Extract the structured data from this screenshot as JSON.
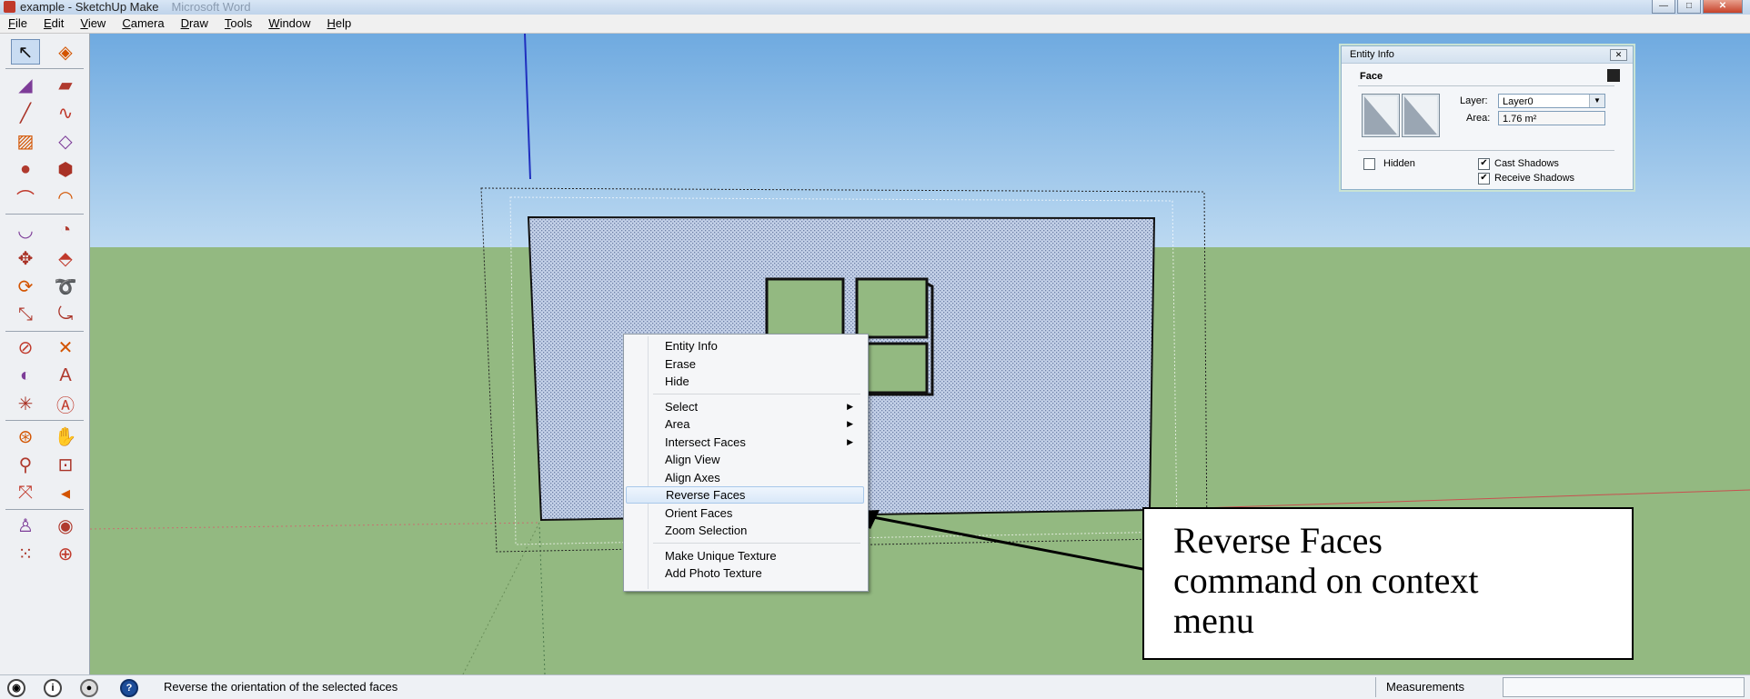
{
  "window": {
    "title": "example - SketchUp Make",
    "title_extra": "Microsoft Word",
    "controls": {
      "minimize": "—",
      "maximize": "□",
      "close": "✕"
    }
  },
  "menubar": {
    "items": [
      {
        "key": "F",
        "rest": "ile"
      },
      {
        "key": "E",
        "rest": "dit"
      },
      {
        "key": "V",
        "rest": "iew"
      },
      {
        "key": "C",
        "rest": "amera"
      },
      {
        "key": "D",
        "rest": "raw"
      },
      {
        "key": "T",
        "rest": "ools"
      },
      {
        "key": "W",
        "rest": "indow"
      },
      {
        "key": "H",
        "rest": "elp"
      }
    ]
  },
  "toolbar": {
    "tools": [
      "select-icon",
      "make-component-icon",
      "paint-bucket-icon",
      "eraser-icon",
      "line-icon",
      "freehand-icon",
      "rectangle-icon",
      "rotated-rectangle-icon",
      "circle-icon",
      "polygon-icon",
      "arc-icon",
      "two-point-arc-icon",
      "three-point-arc-icon",
      "pie-icon",
      "move-icon",
      "push-pull-icon",
      "rotate-icon",
      "follow-me-icon",
      "scale-icon",
      "offset-icon",
      "tape-measure-icon",
      "dimension-icon",
      "protractor-icon",
      "text-icon",
      "axes-icon",
      "3d-text-icon",
      "orbit-icon",
      "pan-icon",
      "zoom-icon",
      "zoom-window-icon",
      "zoom-extents-icon",
      "previous-view-icon",
      "position-camera-icon",
      "look-around-icon",
      "walk-icon",
      "section-plane-icon"
    ]
  },
  "entity_info": {
    "title": "Entity Info",
    "close": "✕",
    "type": "Face",
    "layer_label": "Layer:",
    "layer_value": "Layer0",
    "area_label": "Area:",
    "area_value": "1.76 m²",
    "hidden_label": "Hidden",
    "hidden_checked": false,
    "cast_shadows_label": "Cast Shadows",
    "cast_shadows_checked": true,
    "receive_shadows_label": "Receive Shadows",
    "receive_shadows_checked": true,
    "check_mark": "✔"
  },
  "context_menu": {
    "items": [
      {
        "label": "Entity Info",
        "submenu": false
      },
      {
        "label": "Erase",
        "submenu": false
      },
      {
        "label": "Hide",
        "submenu": false
      },
      {
        "label": "Select",
        "submenu": true
      },
      {
        "label": "Area",
        "submenu": true
      },
      {
        "label": "Intersect Faces",
        "submenu": true
      },
      {
        "label": "Align View",
        "submenu": false
      },
      {
        "label": "Align Axes",
        "submenu": false
      },
      {
        "label": "Reverse Faces",
        "submenu": false,
        "highlighted": true
      },
      {
        "label": "Orient Faces",
        "submenu": false
      },
      {
        "label": "Zoom Selection",
        "submenu": false
      },
      {
        "label": "Make Unique Texture",
        "submenu": false
      },
      {
        "label": "Add Photo Texture",
        "submenu": false
      }
    ],
    "submenu_arrow": "▶"
  },
  "callout": {
    "lines": [
      "Reverse Faces",
      "command on context",
      "menu"
    ]
  },
  "statusbar": {
    "text": "Reverse the orientation of the selected faces",
    "measurements_label": "Measurements",
    "icons": [
      "geo-location-icon",
      "credits-icon",
      "user-icon",
      "instructor-help-icon"
    ],
    "help_glyph": "?"
  },
  "colors": {
    "sky_top": "#6faae0",
    "sky_bottom": "#bcd9f1",
    "ground": "#93b981",
    "selected_face": "#b4c4e0",
    "blue_axis": "#1f2fbf",
    "red_axis": "#c85050",
    "green_axis": "#3f8a3f"
  }
}
